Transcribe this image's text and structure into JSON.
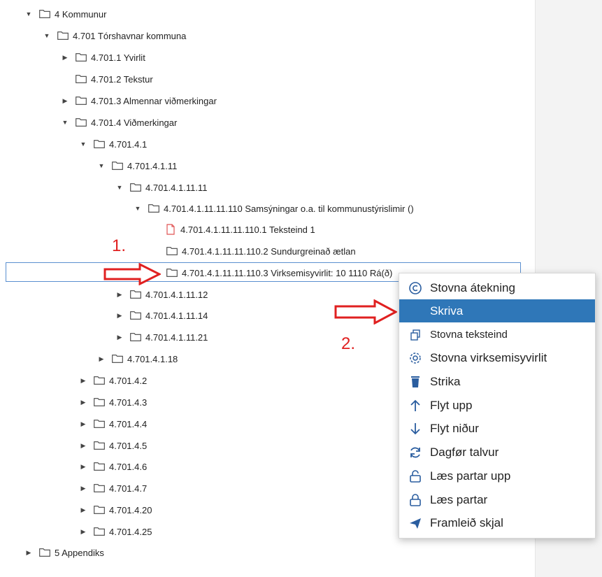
{
  "tree": {
    "nodes": [
      {
        "label": "4 Kommunur",
        "twisty": "▼"
      },
      {
        "label": "4.701 Tórshavnar kommuna",
        "twisty": "▼"
      },
      {
        "label": "4.701.1 Yvirlit",
        "twisty": "▶"
      },
      {
        "label": "4.701.2 Tekstur",
        "twisty": ""
      },
      {
        "label": "4.701.3 Almennar viðmerkingar",
        "twisty": "▶"
      },
      {
        "label": "4.701.4 Viðmerkingar",
        "twisty": "▼"
      },
      {
        "label": "4.701.4.1",
        "twisty": "▼"
      },
      {
        "label": "4.701.4.1.11",
        "twisty": "▼"
      },
      {
        "label": "4.701.4.1.11.11",
        "twisty": "▼"
      },
      {
        "label": "4.701.4.1.11.11.110 Samsýningar o.a. til kommunustýrislimir ()",
        "twisty": "▼"
      },
      {
        "label": "4.701.4.1.11.11.110.1 Teksteind 1",
        "twisty": "",
        "icon": "file"
      },
      {
        "label": "4.701.4.1.11.11.110.2 Sundurgreinað ætlan",
        "twisty": ""
      },
      {
        "label": "4.701.4.1.11.11.110.3 Virksemisyvirlit: 10 1110 Rá(ð)",
        "twisty": ""
      },
      {
        "label": "4.701.4.1.11.12",
        "twisty": "▶"
      },
      {
        "label": "4.701.4.1.11.14",
        "twisty": "▶"
      },
      {
        "label": "4.701.4.1.11.21",
        "twisty": "▶"
      },
      {
        "label": "4.701.4.1.18",
        "twisty": "▶"
      },
      {
        "label": "4.701.4.2",
        "twisty": "▶"
      },
      {
        "label": "4.701.4.3",
        "twisty": "▶"
      },
      {
        "label": "4.701.4.4",
        "twisty": "▶"
      },
      {
        "label": "4.701.4.5",
        "twisty": "▶"
      },
      {
        "label": "4.701.4.6",
        "twisty": "▶"
      },
      {
        "label": "4.701.4.7",
        "twisty": "▶"
      },
      {
        "label": "4.701.4.20",
        "twisty": "▶"
      },
      {
        "label": "4.701.4.25",
        "twisty": "▶"
      },
      {
        "label": "5 Appendiks",
        "twisty": "▶"
      }
    ]
  },
  "annotations": {
    "step1": "1.",
    "step2": "2."
  },
  "context_menu": {
    "items": [
      {
        "label": "Stovna átekning",
        "icon": "copyright-icon"
      },
      {
        "label": "Skriva",
        "icon": "",
        "active": true
      },
      {
        "label": "Stovna teksteind",
        "icon": "copy-icon",
        "small": true
      },
      {
        "label": "Stovna virksemisyvirlit",
        "icon": "gear-icon"
      },
      {
        "label": "Strika",
        "icon": "trash-icon"
      },
      {
        "label": "Flyt upp",
        "icon": "arrow-up-icon"
      },
      {
        "label": "Flyt niður",
        "icon": "arrow-down-icon"
      },
      {
        "label": "Dagfør talvur",
        "icon": "refresh-icon"
      },
      {
        "label": "Læs partar upp",
        "icon": "unlock-icon"
      },
      {
        "label": "Læs partar",
        "icon": "lock-icon"
      },
      {
        "label": "Framleið skjal",
        "icon": "send-icon"
      }
    ]
  },
  "colors": {
    "accent": "#2f77b8",
    "annotation": "#e02020",
    "selection_border": "#5a8fd0"
  }
}
